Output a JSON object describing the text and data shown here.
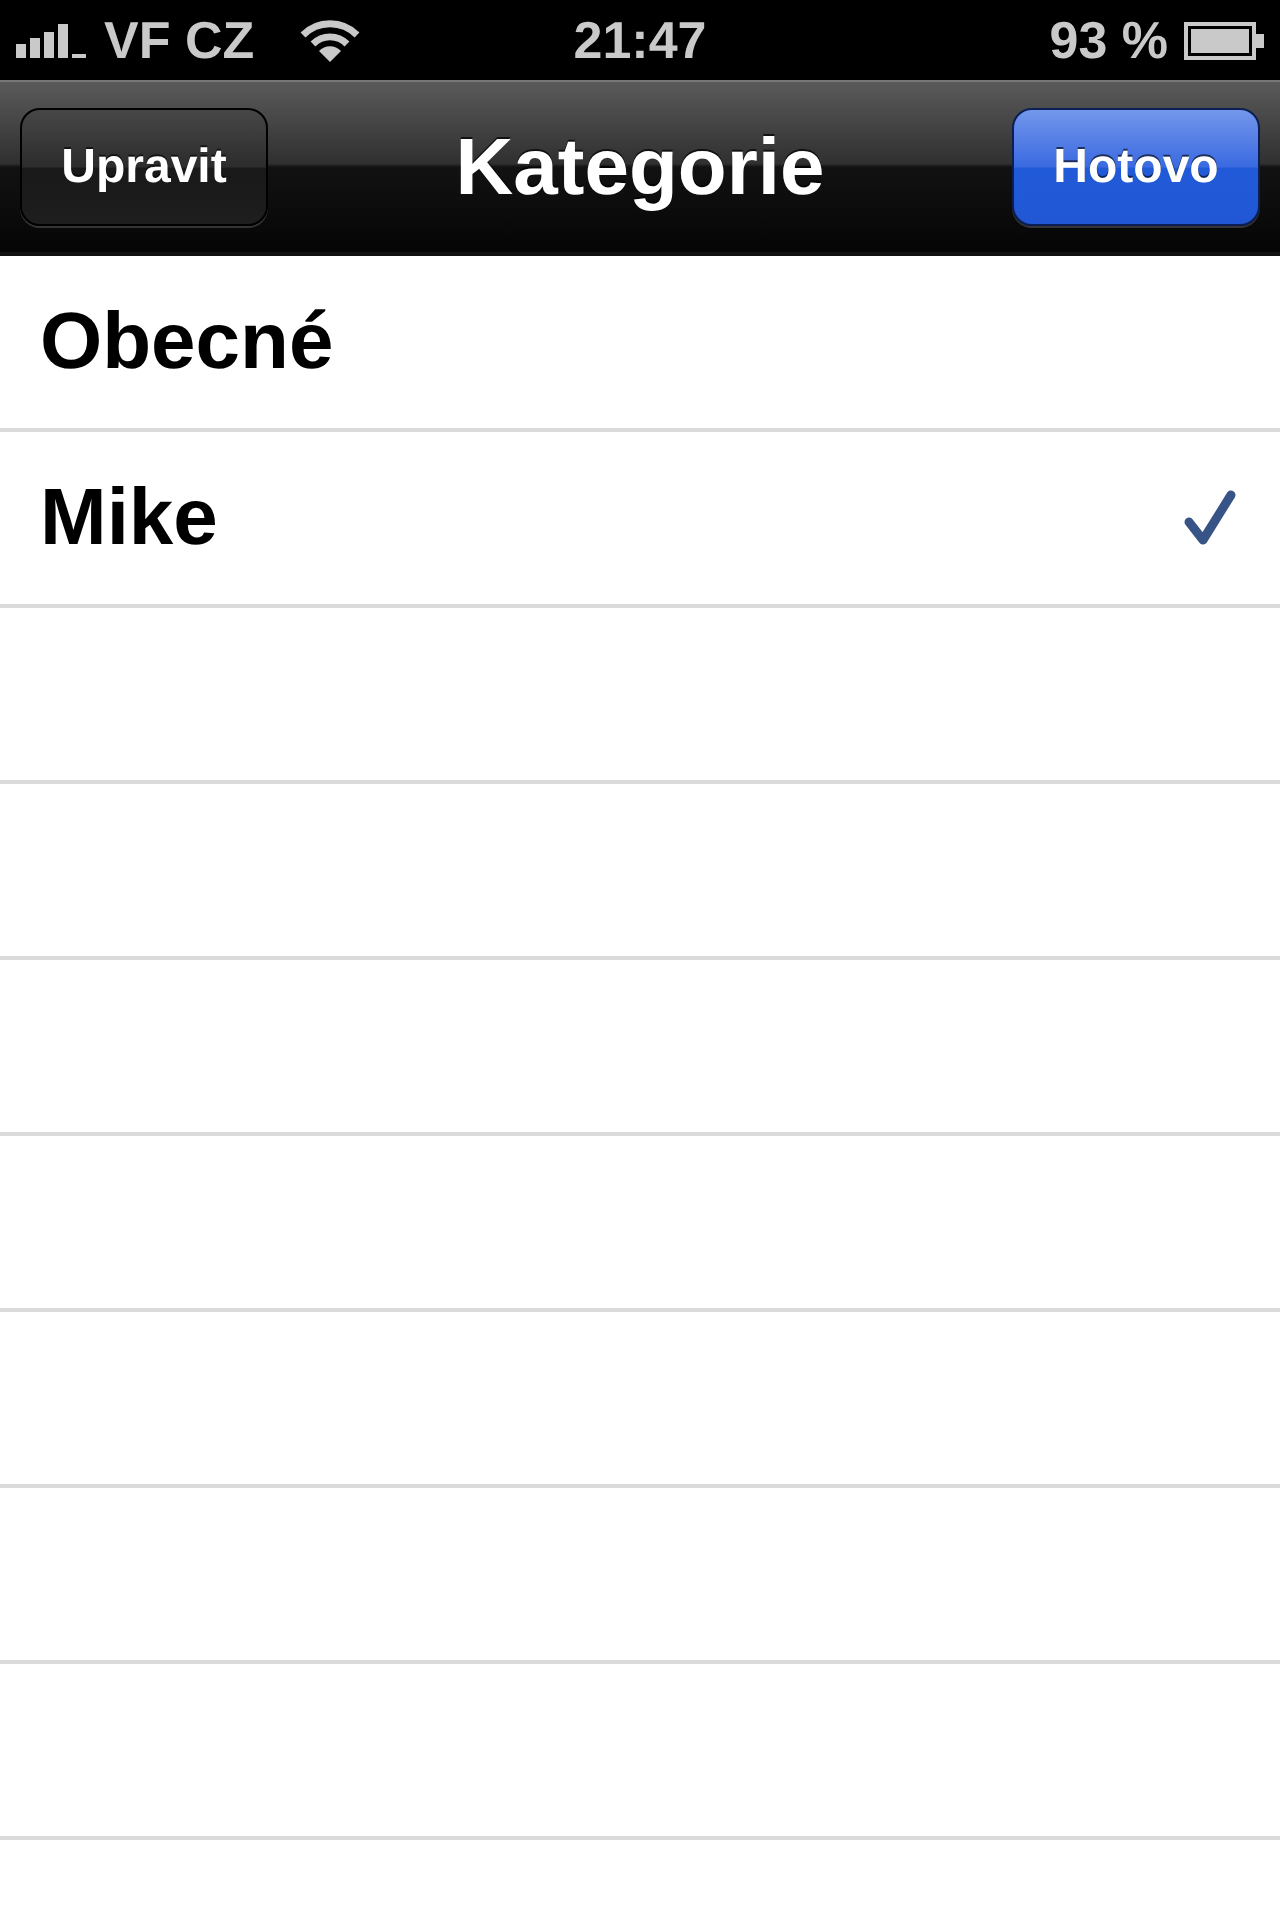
{
  "status_bar": {
    "carrier": "VF CZ",
    "time": "21:47",
    "battery": "93 %"
  },
  "nav_bar": {
    "left_button": "Upravit",
    "title": "Kategorie",
    "right_button": "Hotovo"
  },
  "categories": [
    {
      "name": "Obecné",
      "selected": false
    },
    {
      "name": "Mike",
      "selected": true
    }
  ]
}
